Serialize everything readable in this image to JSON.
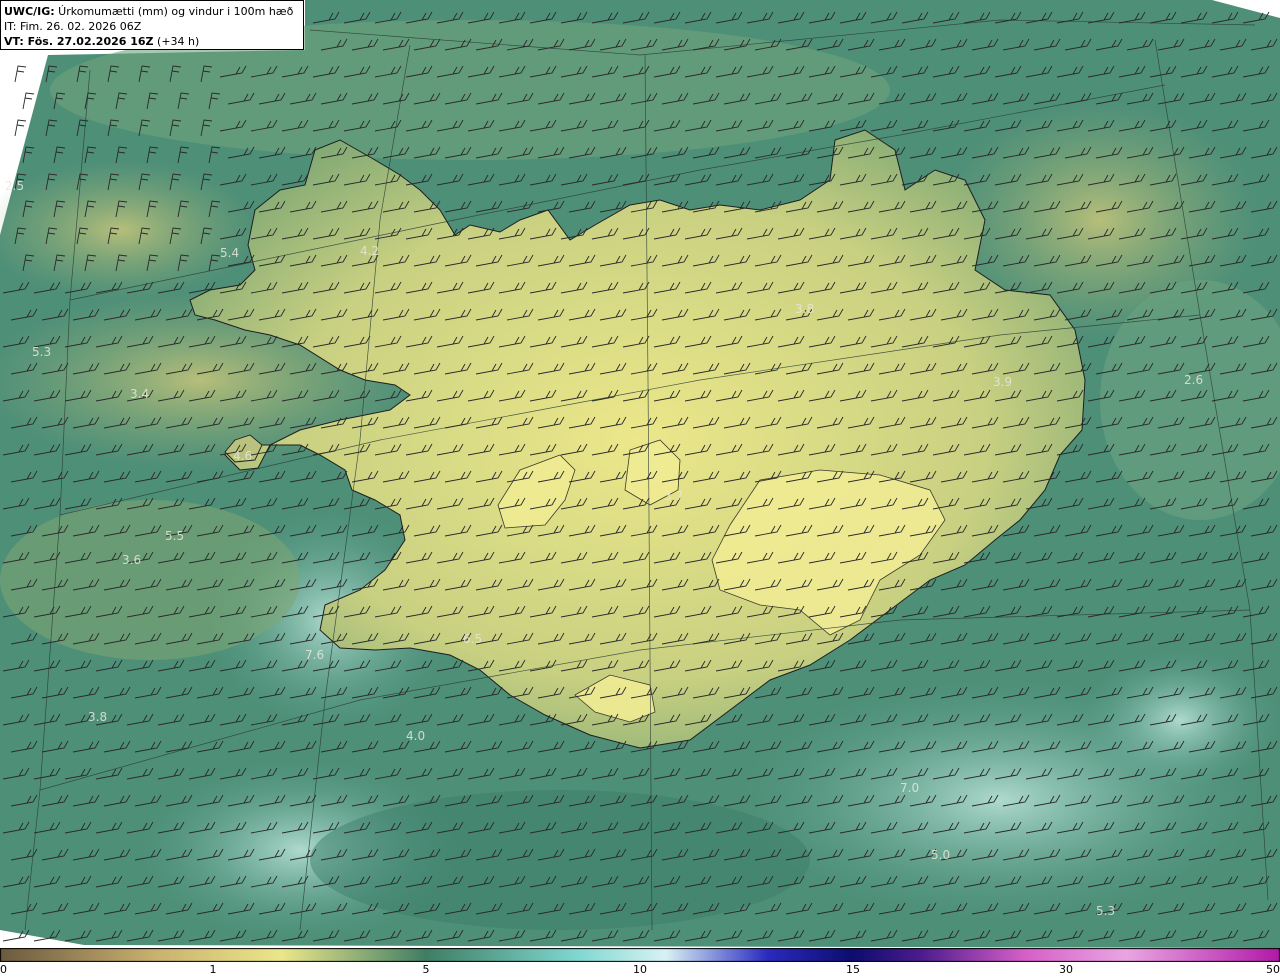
{
  "header": {
    "title_bold": "UWC/IG:",
    "title_rest": " Úrkomumætti (mm) og vindur i 100m hæð",
    "initial_time": "IT: Fim. 26. 02. 2026 06Z",
    "valid_prefix": "VT: Fös. 27.02.2026 16Z",
    "valid_suffix": " (+34 h)"
  },
  "colorbar": {
    "ticks": [
      "0",
      "1",
      "5",
      "10",
      "15",
      "30",
      "50"
    ],
    "colors": [
      "#6b5a3e",
      "#c9b070",
      "#ece78a",
      "#3f7e64",
      "#7fd7d0",
      "#d8f2f4",
      "#2a2abf",
      "#0d0d6e",
      "#4d1c8c",
      "#d65fc8",
      "#e9a6e3",
      "#b01aa6"
    ]
  },
  "map": {
    "labels": [
      {
        "text": "2.5"
      },
      {
        "text": "5.4"
      },
      {
        "text": "4.2"
      },
      {
        "text": "5.3"
      },
      {
        "text": "3.4"
      },
      {
        "text": "4.6"
      },
      {
        "text": "5.5"
      },
      {
        "text": "3.6"
      },
      {
        "text": "7.6"
      },
      {
        "text": "6.5"
      },
      {
        "text": "3.8"
      },
      {
        "text": "4.0"
      },
      {
        "text": "3.8"
      },
      {
        "text": "3.9"
      },
      {
        "text": "2.6"
      },
      {
        "text": "3.7"
      },
      {
        "text": "7.0"
      },
      {
        "text": "5.0"
      },
      {
        "text": "5.3"
      }
    ]
  }
}
